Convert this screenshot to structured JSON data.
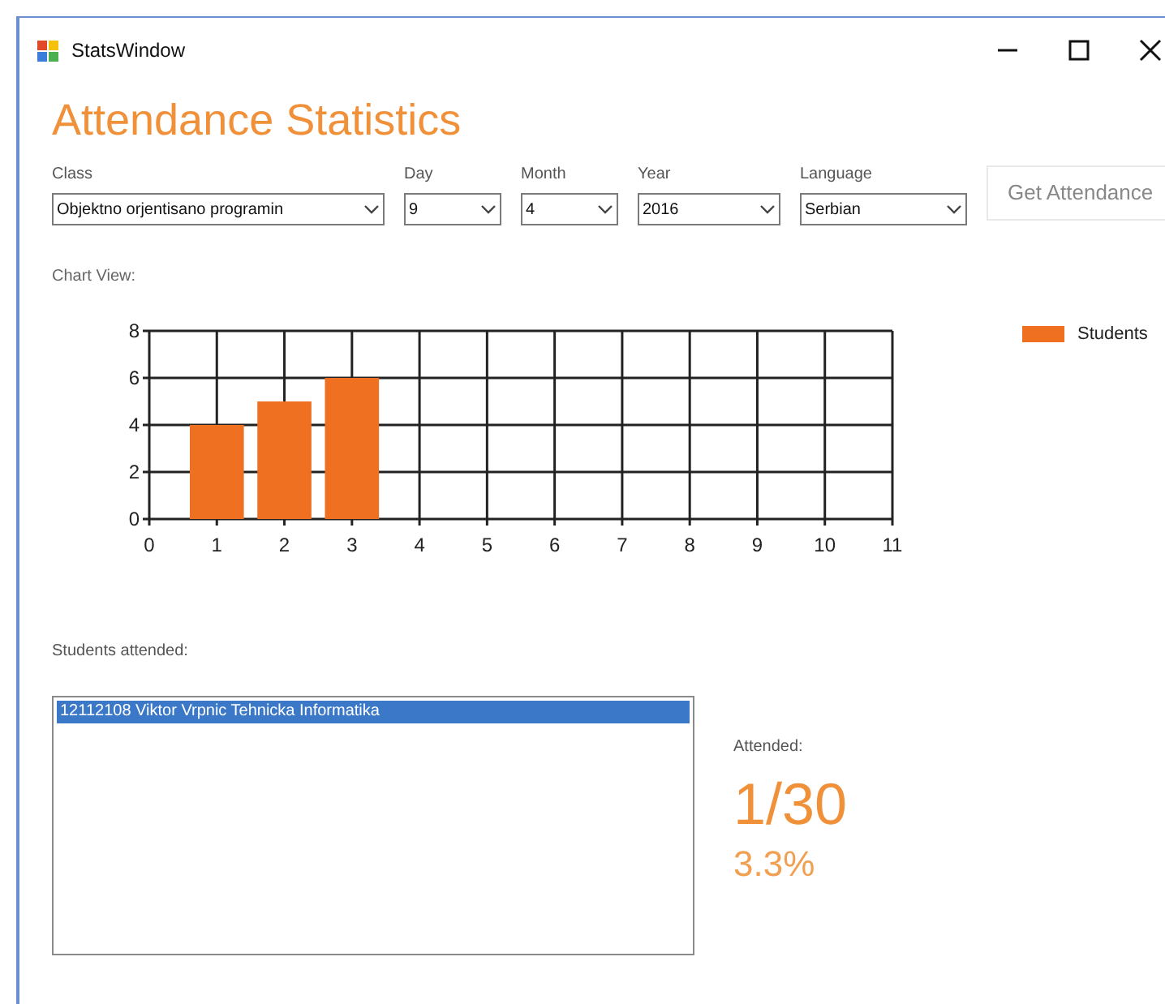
{
  "window": {
    "title": "StatsWindow"
  },
  "heading": "Attendance Statistics",
  "filters": [
    {
      "label": "Class",
      "value": "Objektno orjentisano programin"
    },
    {
      "label": "Day",
      "value": "9"
    },
    {
      "label": "Month",
      "value": "4"
    },
    {
      "label": "Year",
      "value": "2016"
    },
    {
      "label": "Language",
      "value": "Serbian"
    }
  ],
  "get_button": {
    "label": "Get Attendance"
  },
  "chart_label": "Chart View:",
  "chart": {
    "chart_data": {
      "type": "bar",
      "grid": true,
      "x": [
        1,
        2,
        3
      ],
      "series": [
        {
          "name": "Students",
          "color": "#f07022",
          "values": [
            4,
            5,
            6
          ]
        }
      ],
      "xlim": [
        0,
        11
      ],
      "ylim": [
        0,
        8
      ],
      "xticks": [
        0,
        1,
        2,
        3,
        4,
        5,
        6,
        7,
        8,
        9,
        10,
        11
      ],
      "yticks": [
        0,
        2,
        4,
        6,
        8
      ]
    }
  },
  "students_label": "Students attended:",
  "students": [
    {
      "text": "12112108 Viktor Vrpnic Tehnicka Informatika",
      "selected": true
    }
  ],
  "attended": {
    "label": "Attended:",
    "ratio": "1/30",
    "percent": "3.3%"
  }
}
